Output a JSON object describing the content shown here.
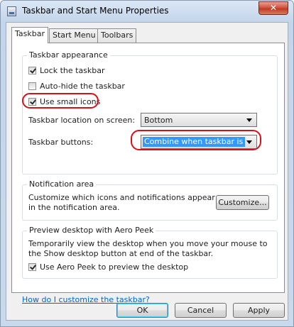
{
  "window": {
    "title": "Taskbar and Start Menu Properties",
    "close_glyph": "✕"
  },
  "tabs": [
    {
      "label": "Taskbar",
      "active": true
    },
    {
      "label": "Start Menu",
      "active": false
    },
    {
      "label": "Toolbars",
      "active": false
    }
  ],
  "appearance": {
    "title": "Taskbar appearance",
    "lock_label": "Lock the taskbar",
    "lock_checked": true,
    "autohide_label": "Auto-hide the taskbar",
    "autohide_checked": false,
    "small_icons_label": "Use small icons",
    "small_icons_checked": true,
    "location_label": "Taskbar location on screen:",
    "location_value": "Bottom",
    "buttons_label": "Taskbar buttons:",
    "buttons_value": "Combine when taskbar is full"
  },
  "notification": {
    "title": "Notification area",
    "description": "Customize which icons and notifications appear in the notification area.",
    "customize_label": "Customize..."
  },
  "peek": {
    "title": "Preview desktop with Aero Peek",
    "description": "Temporarily view the desktop when you move your mouse to the Show desktop button at end of the taskbar.",
    "checkbox_label": "Use Aero Peek to preview the desktop",
    "checked": true
  },
  "help_link": "How do I customize the taskbar?",
  "buttons": {
    "ok": "OK",
    "cancel": "Cancel",
    "apply": "Apply"
  },
  "colors": {
    "highlight_circle": "#d8101a",
    "selection": "#3399ff",
    "link": "#0066cc"
  }
}
